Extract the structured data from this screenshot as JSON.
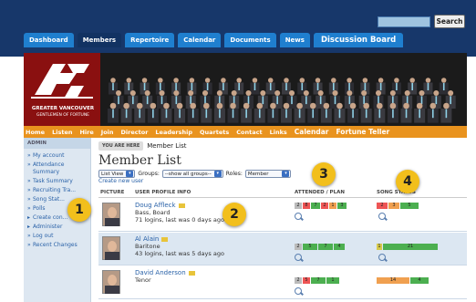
{
  "nav": {
    "tabs": [
      "Dashboard",
      "Members",
      "Repertoire",
      "Calendar",
      "Documents",
      "News",
      "Discussion Board"
    ],
    "search_label": "Search"
  },
  "logo": {
    "line1": "GREATER VANCOUVER",
    "line2": "GENTLEMEN OF FORTUNE"
  },
  "orange_nav": [
    "Home",
    "Listen",
    "Hire",
    "Join",
    "Director",
    "Leadership",
    "Quartets",
    "Contact",
    "Links",
    "Calendar",
    "Fortune Teller"
  ],
  "sidebar": {
    "heading": "ADMIN",
    "items": [
      "My account",
      "Attendance Summary",
      "Task Summary",
      "Recruiting Tra...",
      "Song Stat...",
      "Polls",
      "Create con...",
      "Administer",
      "Log out",
      "Recent Changes"
    ]
  },
  "main": {
    "crumb_tag": "YOU ARE HERE",
    "crumb": "Member List",
    "title": "Member List",
    "view_select": "List View",
    "groups_label": "Groups:",
    "groups_select": "--show all groups--",
    "roles_label": "Roles:",
    "roles_select": "Member",
    "create_link": "Create new user",
    "col_picture": "PICTURE",
    "col_profile": "USER PROFILE INFO",
    "col_attended": "ATTENDED / PLAN",
    "col_song": "SONG STATUS"
  },
  "rows": [
    {
      "name": "Doug Affleck",
      "role": "Bass, Board",
      "logins": "71 logins, last was 0 days ago",
      "attended": [
        "2",
        "8",
        "7",
        "2",
        "1",
        "3"
      ],
      "song": [
        "2",
        "3",
        "5"
      ]
    },
    {
      "name": "Al Alain",
      "role": "Baritone",
      "logins": "43 logins, last was 5 days ago",
      "attended": [
        "2",
        "5",
        "7",
        "4"
      ],
      "song": [
        "1",
        "21"
      ]
    },
    {
      "name": "David Anderson",
      "role": "Tenor",
      "logins": "",
      "attended": [
        "2",
        "5",
        "7",
        "1"
      ],
      "song": [
        "14",
        "4"
      ]
    }
  ],
  "badges": [
    "1",
    "2",
    "3",
    "4"
  ],
  "colors": {
    "nav_bg": "#17376a",
    "tab": "#1f7fcf",
    "orange": "#e9931e",
    "badge": "#f2bf1c"
  }
}
